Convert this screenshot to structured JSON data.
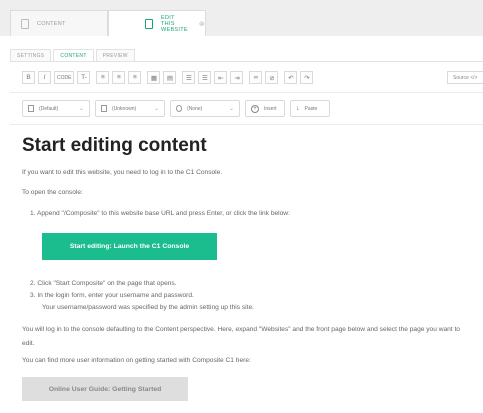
{
  "doc_tabs": [
    {
      "label": "CONTENT"
    },
    {
      "label": "EDIT THIS WEBSITE",
      "close": "⊗"
    }
  ],
  "editor_tabs": [
    {
      "label": "SETTINGS"
    },
    {
      "label": "CONTENT"
    },
    {
      "label": "PREVIEW"
    }
  ],
  "toolbar": {
    "bold": "B",
    "italic": "I",
    "code": "CODE",
    "clear_format": "T-",
    "source_label": "Source </>"
  },
  "dropdowns": {
    "paragraph": "(Default)",
    "table": "(Unknown)",
    "class": "(None)",
    "insert": "Insert",
    "paste": "Paste"
  },
  "content": {
    "heading": "Start editing content",
    "intro": "If you want to edit this website, you need to log in to the C1 Console.",
    "open_console": "To open the console:",
    "step1": "1.  Append \"/Composite\" to this website base URL and press Enter, or click the link below:",
    "launch_button": "Start editing: Launch the C1 Console",
    "step2": "2.  Click \"Start Composite\" on the page that opens.",
    "step3": "3.  In the login form, enter your username and password.",
    "step3_note": "Your username/password was specified by the admin setting up this site.",
    "perspective_text": "You will log in to the console defaulting to the Content perspective. Here, expand \"Websites\" and the front page below and select the page you want to edit.",
    "more_info": "You can find more user information on getting started with Composite C1 here:",
    "guide_button": "Online User Guide: Getting Started"
  },
  "colors": {
    "accent": "#1aa478",
    "button_green": "#1bbd8e",
    "button_grey": "#dedede"
  }
}
